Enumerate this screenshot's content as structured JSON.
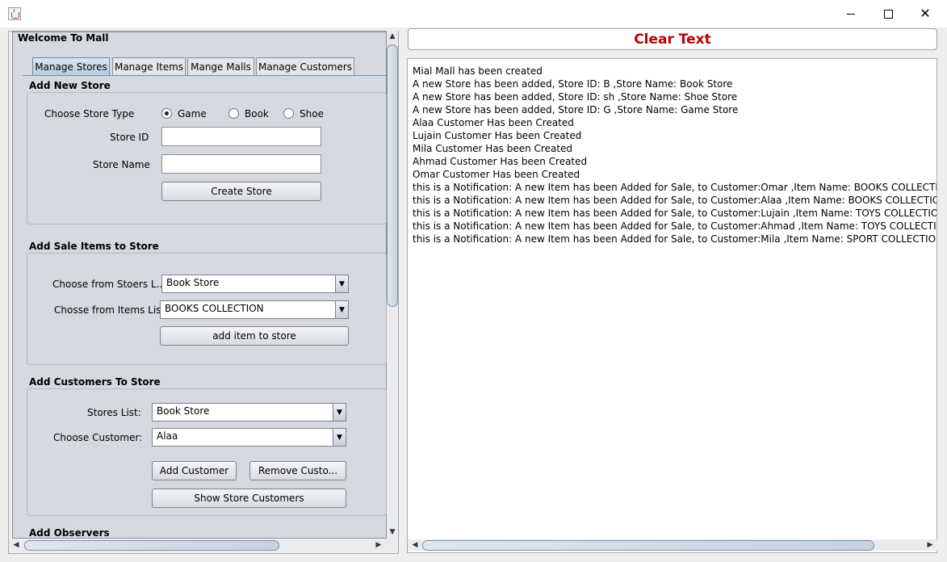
{
  "window": {
    "app_icon": "java-cup-icon"
  },
  "left_panel": {
    "title": "Welcome To Mall",
    "tabs": [
      {
        "label": "Manage Stores",
        "active": true
      },
      {
        "label": "Manage Items"
      },
      {
        "label": "Mange Malls"
      },
      {
        "label": "Manage Customers"
      }
    ],
    "add_new_store": {
      "title": "Add New Store",
      "store_type_label": "Choose Store Type",
      "store_types": [
        "Game",
        "Book",
        "Shoe"
      ],
      "selected_type": "Game",
      "store_id_label": "Store ID",
      "store_id_value": "",
      "store_name_label": "Store Name",
      "store_name_value": "",
      "create_button": "Create Store"
    },
    "add_sale_items": {
      "title": "Add Sale Items to Store",
      "stores_list_label": "Choose from Stoers L...",
      "stores_list_value": "Book Store",
      "items_list_label": "Chosse from Items List",
      "items_list_value": "BOOKS COLLECTION",
      "add_button": "add item to store"
    },
    "add_customers": {
      "title": "Add Customers To Store",
      "stores_label": "Stores List:",
      "stores_value": "Book Store",
      "customer_label": "Choose Customer:",
      "customer_value": "Alaa",
      "add_button": "Add Customer",
      "remove_button": "Remove Custo...",
      "show_button": "Show Store Customers"
    },
    "add_observers": {
      "title": "Add Observers"
    }
  },
  "right_panel": {
    "clear_button": "Clear Text",
    "clear_color": "#c00000",
    "log_lines": [
      "Mial Mall has been created",
      "A new Store has been added, Store ID: B ,Store Name: Book Store",
      "A new Store has been added, Store ID: sh ,Store Name: Shoe Store",
      "A new Store has been added, Store ID: G ,Store Name: Game Store",
      "Alaa Customer Has been Created",
      "Lujain Customer Has been Created",
      "Mila Customer Has been Created",
      "Ahmad Customer Has been Created",
      "Omar Customer Has been Created",
      "this is a Notification: A new Item has been Added for Sale, to Customer:Omar ,Item Name: BOOKS COLLECTION ,Item Pri",
      "this is a Notification: A new Item has been Added for Sale, to Customer:Alaa ,Item Name: BOOKS COLLECTION ,Item Pri",
      "this is a Notification: A new Item has been Added for Sale, to Customer:Lujain ,Item Name: TOYS COLLECTION ,Item Pri",
      "this is a Notification: A new Item has been Added for Sale, to Customer:Ahmad ,Item Name: TOYS COLLECTION ,Item Pri",
      "this is a Notification: A new Item has been Added for Sale, to Customer:Mila ,Item Name: SPORT COLLECTION ,Item Pric"
    ]
  }
}
